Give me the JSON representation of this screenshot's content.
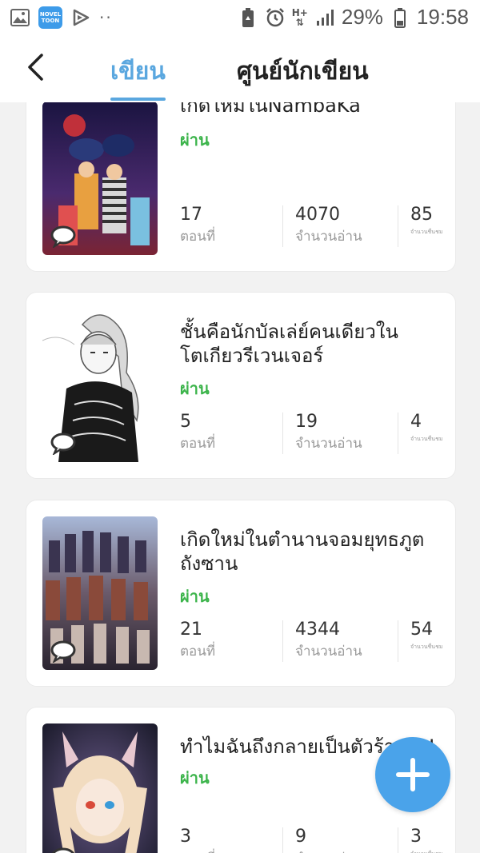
{
  "status_bar": {
    "app_badge_line1": "NOVEL",
    "app_badge_line2": "TOON",
    "dots": "··",
    "network_top": "H+",
    "battery": "29%",
    "time": "19:58"
  },
  "header": {
    "tab_write": "เขียน",
    "tab_writer_center": "ศูนย์นักเขียน"
  },
  "labels": {
    "status": "ผ่าน",
    "episodes": "ตอนที่",
    "reads": "จำนวนอ่าน",
    "likes": "จำนวนชื่นชม"
  },
  "books": [
    {
      "title": "เกิดใหม่ในNambaKa",
      "status": "ผ่าน",
      "episodes": "17",
      "reads": "4070",
      "likes": "85"
    },
    {
      "title": "ชั้นคือนักบัลเล่ย์คนเดียวในโตเกียวรีเวนเจอร์",
      "status": "ผ่าน",
      "episodes": "5",
      "reads": "19",
      "likes": "4"
    },
    {
      "title": "เกิดใหม่ในตำนานจอมยุทธภูตถังซาน",
      "status": "ผ่าน",
      "episodes": "21",
      "reads": "4344",
      "likes": "54"
    },
    {
      "title": "ทำไมฉันถึงกลายเป็นตัวร้ายล่ะ!!",
      "status": "ผ่าน",
      "episodes": "3",
      "reads": "9",
      "likes": "3"
    }
  ],
  "colors": {
    "accent": "#5aa7df",
    "status_green": "#3cb44b",
    "fab": "#4aa3ea"
  },
  "icons": [
    "gallery-icon",
    "novel-toon-icon",
    "play-icon",
    "battery-saver-icon",
    "alarm-icon",
    "signal-icon",
    "battery-icon",
    "back-arrow-icon",
    "comment-bubble-icon",
    "plus-icon"
  ]
}
